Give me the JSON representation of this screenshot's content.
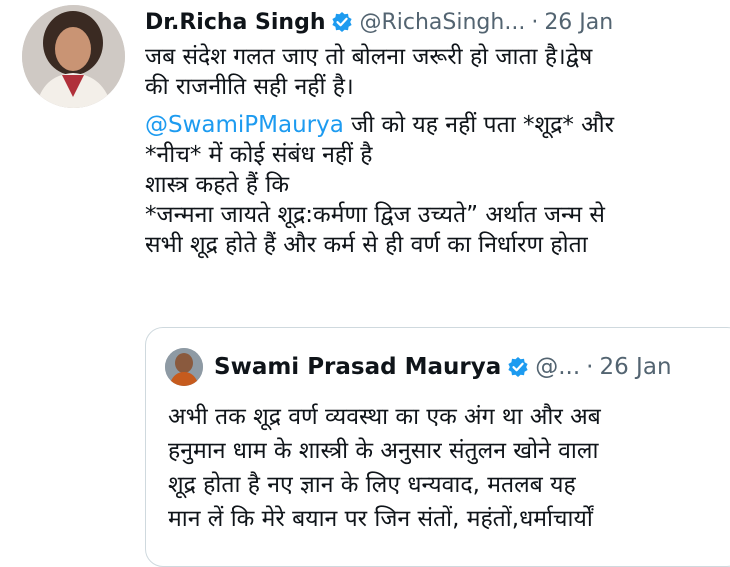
{
  "tweet": {
    "author_name": "Dr.Richa Singh",
    "author_handle": "@RichaSingh...",
    "separator": "·",
    "time": "26 Jan",
    "verified_icon": "verified-badge-icon",
    "body_lines": [
      "जब संदेश गलत जाए तो बोलना जरूरी हो जाता है।द्वेष",
      "की राजनीति सही नहीं है।"
    ],
    "mention": "@SwamiPMaurya",
    "after_mention": " जी को यह नहीं पता *शूद्र* और",
    "more_lines": [
      "*नीच* में कोई संबंध नहीं है",
      "शास्त्र कहते हैं कि",
      "*जन्मना जायते शूद्र:कर्मणा द्विज उच्यते” अर्थात जन्म से",
      "सभी शूद्र होते हैं और कर्म से ही वर्ण का निर्धारण होता"
    ]
  },
  "quoted": {
    "author_name": "Swami Prasad Maurya",
    "author_handle": "@...",
    "separator": "·",
    "time": "26 Jan",
    "body_lines": [
      "अभी तक शूद्र वर्ण व्यवस्था का एक अंग था  और अब",
      "हनुमान धाम के शास्त्री के अनुसार संतुलन खोने वाला",
      "शूद्र होता है नए ज्ञान के लिए धन्यवाद, मतलब यह",
      "मान लें कि मेरे बयान पर जिन संतों, महंतों,धर्माचार्यों"
    ]
  },
  "colors": {
    "mention": "#1d9bf0",
    "verified": "#1d9bf0",
    "secondary_text": "#536471",
    "quote_border": "#cfd9de"
  }
}
